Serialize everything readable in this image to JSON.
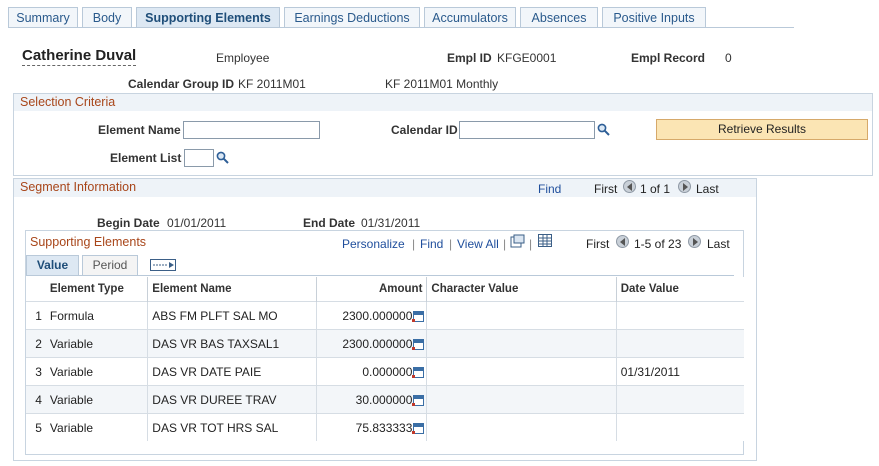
{
  "tabs": [
    {
      "label": "Summary"
    },
    {
      "label": "Body"
    },
    {
      "label": "Supporting Elements"
    },
    {
      "label": "Earnings Deductions"
    },
    {
      "label": "Accumulators"
    },
    {
      "label": "Absences"
    },
    {
      "label": "Positive Inputs"
    }
  ],
  "header": {
    "employee_name": "Catherine Duval",
    "employee_label": "Employee",
    "empl_id_label": "Empl ID",
    "empl_id_value": "KFGE0001",
    "empl_record_label": "Empl Record",
    "empl_record_value": "0",
    "calendar_group_label": "Calendar Group ID",
    "calendar_group_value": "KF 2011M01",
    "calendar_group_desc": "KF 2011M01 Monthly"
  },
  "selection": {
    "title": "Selection Criteria",
    "element_name_label": "Element Name",
    "element_name_value": "",
    "calendar_id_label": "Calendar ID",
    "calendar_id_value": "",
    "element_list_label": "Element List",
    "element_list_value": "",
    "retrieve_button": "Retrieve Results"
  },
  "segment": {
    "title": "Segment Information",
    "find": "Find",
    "first": "First",
    "counter": "1 of 1",
    "last": "Last",
    "begin_date_label": "Begin Date",
    "begin_date_value": "01/01/2011",
    "end_date_label": "End Date",
    "end_date_value": "01/31/2011"
  },
  "supporting": {
    "title": "Supporting Elements",
    "personalize": "Personalize",
    "find": "Find",
    "view_all": "View All",
    "first": "First",
    "counter": "1-5 of 23",
    "last": "Last",
    "subtabs": [
      "Value",
      "Period"
    ],
    "columns": [
      "Element Type",
      "Element Name",
      "Amount",
      "Character Value",
      "Date Value"
    ],
    "rows": [
      {
        "num": "1",
        "type": "Formula",
        "name": "ABS FM PLFT SAL MO",
        "amount": "2300.000000",
        "char": "",
        "date": ""
      },
      {
        "num": "2",
        "type": "Variable",
        "name": "DAS VR BAS TAXSAL1",
        "amount": "2300.000000",
        "char": "",
        "date": ""
      },
      {
        "num": "3",
        "type": "Variable",
        "name": "DAS VR DATE PAIE",
        "amount": "0.000000",
        "char": "",
        "date": "01/31/2011"
      },
      {
        "num": "4",
        "type": "Variable",
        "name": "DAS VR DUREE TRAV",
        "amount": "30.000000",
        "char": "",
        "date": ""
      },
      {
        "num": "5",
        "type": "Variable",
        "name": "DAS VR TOT HRS SAL",
        "amount": "75.833333",
        "char": "",
        "date": ""
      }
    ]
  }
}
